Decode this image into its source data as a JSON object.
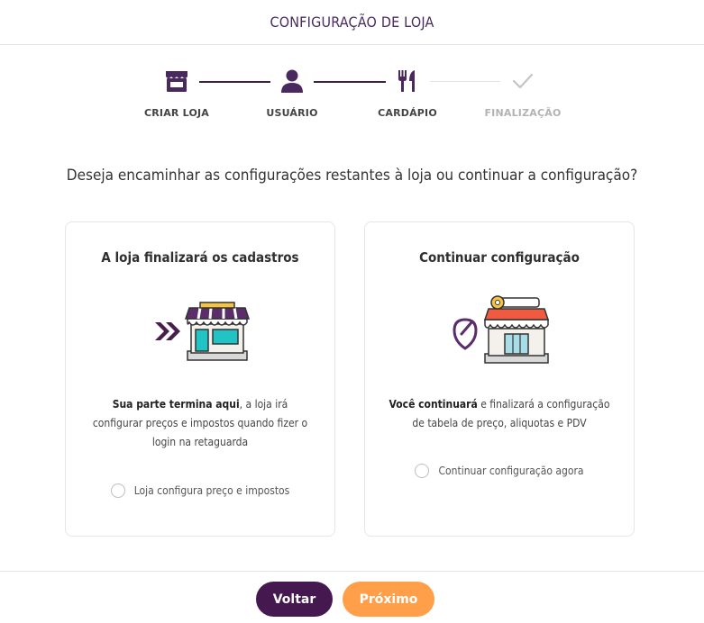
{
  "header": {
    "title": "CONFIGURAÇÃO DE LOJA"
  },
  "stepper": {
    "steps": [
      {
        "label": "CRIAR LOJA",
        "icon": "store-icon",
        "state": "done"
      },
      {
        "label": "USUÁRIO",
        "icon": "user-icon",
        "state": "done"
      },
      {
        "label": "CARDÁPIO",
        "icon": "utensils-icon",
        "state": "current"
      },
      {
        "label": "FINALIZAÇÃO",
        "icon": "check-icon",
        "state": "pending"
      }
    ],
    "active_color": "#3b2040",
    "inactive_color": "#b3b3b3"
  },
  "question": "Deseja encaminhar as configurações restantes à loja ou continuar a configuração?",
  "cards": [
    {
      "title": "A loja finalizará os cadastros",
      "desc_bold": "Sua parte termina aqui",
      "desc_rest": ", a loja irá configurar preços e impostos quando fizer o login na retaguarda",
      "option_label": "Loja configura preço e impostos",
      "illustration": "store-with-arrows-icon"
    },
    {
      "title": "Continuar configuração",
      "desc_bold": "Você continuará",
      "desc_rest": " e finalizará a configuração de tabela de preço, aliquotas e PDV",
      "option_label": "Continuar configuração agora",
      "illustration": "store-with-tag-icon"
    }
  ],
  "footer": {
    "back_label": "Voltar",
    "next_label": "Próximo",
    "back_color": "#45194f",
    "next_color": "#ff9f4a"
  }
}
